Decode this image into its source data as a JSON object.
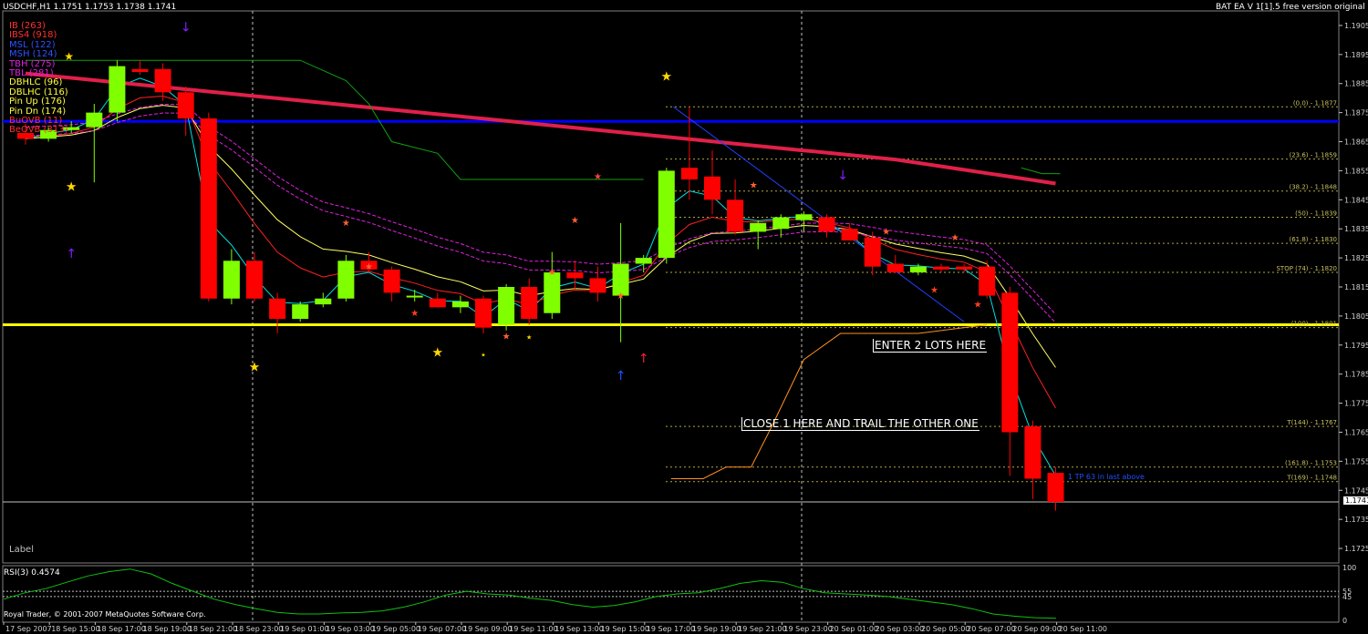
{
  "window": {
    "symbol_info": "USDCHF,H1  1.1751 1.1753 1.1738 1.1741",
    "ea_title": "BAT EA V 1[1].5 free version original ☺"
  },
  "legend": [
    {
      "text": "IB (263)",
      "color": "#ff3030"
    },
    {
      "text": "IBS4 (918)",
      "color": "#ff3030"
    },
    {
      "text": "MSL (122)",
      "color": "#3050ff"
    },
    {
      "text": "MSH (124)",
      "color": "#3050ff"
    },
    {
      "text": "TBH (275)",
      "color": "#e020e0"
    },
    {
      "text": "TBL (281)",
      "color": "#e020e0"
    },
    {
      "text": "DBHLC (96)",
      "color": "#ffff40"
    },
    {
      "text": "DBLHC (116)",
      "color": "#ffff40"
    },
    {
      "text": "Pin Up (176)",
      "color": "#ffff40"
    },
    {
      "text": "Pin Dn (174)",
      "color": "#ffff40"
    },
    {
      "text": "BuOVB (11)",
      "color": "#ff3030"
    },
    {
      "text": "BeOVB (313)",
      "color": "#ff3030"
    }
  ],
  "chart_data": {
    "type": "candlestick",
    "symbol": "USDCHF",
    "timeframe": "H1",
    "ohlc_header": {
      "open": 1.1751,
      "high": 1.1753,
      "low": 1.1738,
      "close": 1.1741
    },
    "y_ticks": [
      "1.1905",
      "1.1885",
      "1.1865",
      "1.1845",
      "1.1825",
      "1.1805",
      "1.1785",
      "1.1765",
      "1.1745",
      "1.1725",
      "1.1895",
      "1.1875",
      "1.1855",
      "1.1835",
      "1.1815",
      "1.1795",
      "1.1775",
      "1.1755",
      "1.1735"
    ],
    "price_axis": [
      "1.1905",
      "1.1895",
      "1.1885",
      "1.1875",
      "1.1865",
      "1.1855",
      "1.1845",
      "1.1835",
      "1.1825",
      "1.1815",
      "1.1805",
      "1.1795",
      "1.1785",
      "1.1775",
      "1.1765",
      "1.1755",
      "1.1745",
      "1.1735",
      "1.1725"
    ],
    "ylim": [
      1.172,
      1.191
    ],
    "current_price": "1.1741",
    "time_axis": [
      "17 Sep 2007",
      "18 Sep 15:00",
      "18 Sep 17:00",
      "18 Sep 19:00",
      "18 Sep 21:00",
      "18 Sep 23:00",
      "19 Sep 01:00",
      "19 Sep 03:00",
      "19 Sep 05:00",
      "19 Sep 07:00",
      "19 Sep 09:00",
      "19 Sep 11:00",
      "19 Sep 13:00",
      "19 Sep 15:00",
      "19 Sep 17:00",
      "19 Sep 19:00",
      "19 Sep 21:00",
      "19 Sep 23:00",
      "20 Sep 01:00",
      "20 Sep 03:00",
      "20 Sep 05:00",
      "20 Sep 07:00",
      "20 Sep 09:00",
      "20 Sep 11:00"
    ],
    "candles": [
      {
        "o": 1.1868,
        "h": 1.1871,
        "l": 1.1864,
        "c": 1.1866
      },
      {
        "o": 1.1866,
        "h": 1.187,
        "l": 1.1865,
        "c": 1.1869
      },
      {
        "o": 1.1869,
        "h": 1.1872,
        "l": 1.1868,
        "c": 1.187
      },
      {
        "o": 1.187,
        "h": 1.1878,
        "l": 1.1851,
        "c": 1.1875
      },
      {
        "o": 1.1875,
        "h": 1.1893,
        "l": 1.1872,
        "c": 1.1891
      },
      {
        "o": 1.189,
        "h": 1.1893,
        "l": 1.1888,
        "c": 1.1889
      },
      {
        "o": 1.189,
        "h": 1.1892,
        "l": 1.1879,
        "c": 1.1882
      },
      {
        "o": 1.1882,
        "h": 1.1884,
        "l": 1.1867,
        "c": 1.1873
      },
      {
        "o": 1.1873,
        "h": 1.1875,
        "l": 1.181,
        "c": 1.1811
      },
      {
        "o": 1.1811,
        "h": 1.1828,
        "l": 1.1809,
        "c": 1.1824
      },
      {
        "o": 1.1824,
        "h": 1.1827,
        "l": 1.181,
        "c": 1.1811
      },
      {
        "o": 1.1811,
        "h": 1.1813,
        "l": 1.1799,
        "c": 1.1804
      },
      {
        "o": 1.1804,
        "h": 1.181,
        "l": 1.1803,
        "c": 1.1809
      },
      {
        "o": 1.1809,
        "h": 1.1813,
        "l": 1.1808,
        "c": 1.1811
      },
      {
        "o": 1.1811,
        "h": 1.1826,
        "l": 1.181,
        "c": 1.1824
      },
      {
        "o": 1.1824,
        "h": 1.1827,
        "l": 1.182,
        "c": 1.1821
      },
      {
        "o": 1.1821,
        "h": 1.1822,
        "l": 1.181,
        "c": 1.1813
      },
      {
        "o": 1.1812,
        "h": 1.1814,
        "l": 1.181,
        "c": 1.1812
      },
      {
        "o": 1.1811,
        "h": 1.1813,
        "l": 1.1808,
        "c": 1.1808
      },
      {
        "o": 1.1808,
        "h": 1.1812,
        "l": 1.1806,
        "c": 1.181
      },
      {
        "o": 1.1811,
        "h": 1.1812,
        "l": 1.1799,
        "c": 1.1801
      },
      {
        "o": 1.1802,
        "h": 1.1816,
        "l": 1.18,
        "c": 1.1815
      },
      {
        "o": 1.1815,
        "h": 1.1818,
        "l": 1.1802,
        "c": 1.1804
      },
      {
        "o": 1.1806,
        "h": 1.1827,
        "l": 1.1804,
        "c": 1.182
      },
      {
        "o": 1.182,
        "h": 1.1824,
        "l": 1.1814,
        "c": 1.1818
      },
      {
        "o": 1.1818,
        "h": 1.1822,
        "l": 1.181,
        "c": 1.1813
      },
      {
        "o": 1.1812,
        "h": 1.1837,
        "l": 1.1796,
        "c": 1.1823
      },
      {
        "o": 1.1823,
        "h": 1.1826,
        "l": 1.182,
        "c": 1.1825
      },
      {
        "o": 1.1825,
        "h": 1.1856,
        "l": 1.1823,
        "c": 1.1855
      },
      {
        "o": 1.1856,
        "h": 1.1877,
        "l": 1.1845,
        "c": 1.1852
      },
      {
        "o": 1.1853,
        "h": 1.1862,
        "l": 1.184,
        "c": 1.1845
      },
      {
        "o": 1.1845,
        "h": 1.1852,
        "l": 1.1833,
        "c": 1.1834
      },
      {
        "o": 1.1834,
        "h": 1.1838,
        "l": 1.1828,
        "c": 1.1837
      },
      {
        "o": 1.1835,
        "h": 1.184,
        "l": 1.1832,
        "c": 1.1839
      },
      {
        "o": 1.1838,
        "h": 1.1841,
        "l": 1.1834,
        "c": 1.184
      },
      {
        "o": 1.1839,
        "h": 1.184,
        "l": 1.1832,
        "c": 1.1834
      },
      {
        "o": 1.1835,
        "h": 1.1837,
        "l": 1.1831,
        "c": 1.1831
      },
      {
        "o": 1.1832,
        "h": 1.1834,
        "l": 1.1819,
        "c": 1.1822
      },
      {
        "o": 1.1823,
        "h": 1.1826,
        "l": 1.182,
        "c": 1.182
      },
      {
        "o": 1.182,
        "h": 1.1823,
        "l": 1.1819,
        "c": 1.1822
      },
      {
        "o": 1.1822,
        "h": 1.1823,
        "l": 1.182,
        "c": 1.1821
      },
      {
        "o": 1.1822,
        "h": 1.1823,
        "l": 1.182,
        "c": 1.1821
      },
      {
        "o": 1.1822,
        "h": 1.1824,
        "l": 1.1811,
        "c": 1.1812
      },
      {
        "o": 1.1813,
        "h": 1.1815,
        "l": 1.175,
        "c": 1.1765
      },
      {
        "o": 1.1767,
        "h": 1.1769,
        "l": 1.1742,
        "c": 1.1749
      },
      {
        "o": 1.1751,
        "h": 1.1753,
        "l": 1.1738,
        "c": 1.1741
      }
    ],
    "fib_levels": [
      {
        "label": "(0.0) - 1.1877",
        "price": 1.1877
      },
      {
        "label": "(23.6) - 1.1859",
        "price": 1.1859
      },
      {
        "label": "(38.2) - 1.1848",
        "price": 1.1848
      },
      {
        "label": "(50) - 1.1839",
        "price": 1.1839
      },
      {
        "label": "(61.8) - 1.1830",
        "price": 1.183
      },
      {
        "label": "STOP (74) - 1.1820",
        "price": 1.182
      },
      {
        "label": "(100) - 1.1801",
        "price": 1.1801
      },
      {
        "label": "T(144) - 1.1767",
        "price": 1.1767
      },
      {
        "label": "(161.8) - 1.1753",
        "price": 1.1753
      },
      {
        "label": "T(169) - 1.1748",
        "price": 1.1748
      }
    ],
    "horizontal_lines": [
      {
        "name": "blue-resistance",
        "price": 1.1872,
        "color": "#0000ff"
      },
      {
        "name": "yellow-support",
        "price": 1.1802,
        "color": "#ffff00"
      },
      {
        "name": "current-price",
        "price": 1.1741,
        "color": "#c0c0c0"
      }
    ],
    "annotations": [
      {
        "text": "ENTER 2 LOTS HERE"
      },
      {
        "text": "CLOSE 1 HERE AND TRAIL THE OTHER ONE"
      }
    ],
    "blue_note": "1 TP 63 in last above",
    "bottom_label": "Label",
    "rsi": {
      "label": "RSI(3) 0.4574",
      "scale": [
        "100",
        "55",
        "45",
        "0"
      ],
      "values": [
        40,
        52,
        60,
        72,
        84,
        92,
        97,
        88,
        70,
        55,
        40,
        30,
        22,
        15,
        12,
        12,
        14,
        15,
        18,
        25,
        35,
        48,
        55,
        50,
        48,
        42,
        38,
        30,
        25,
        28,
        35,
        45,
        50,
        52,
        60,
        70,
        75,
        72,
        60,
        52,
        50,
        48,
        45,
        40,
        35,
        30,
        22,
        12,
        8,
        5,
        4
      ]
    }
  },
  "footer": {
    "copyright": "Royal Trader, © 2001-2007 MetaQuotes Software Corp."
  },
  "colors": {
    "bull": "#80ff00",
    "bear": "#ff0000",
    "ma_red": "#e0204a",
    "grid": "#ffffff"
  }
}
